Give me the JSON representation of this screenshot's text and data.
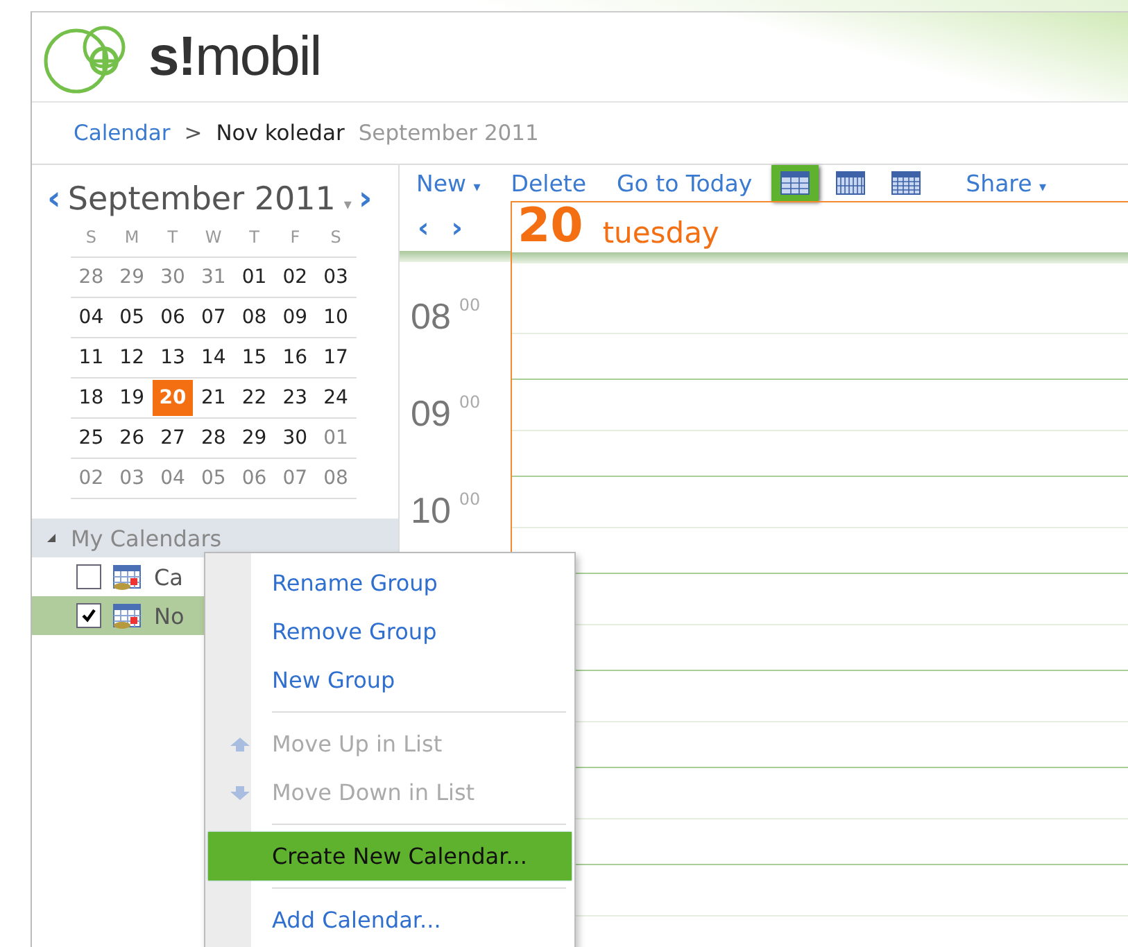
{
  "brand": {
    "name_left": "s!",
    "name_right": "mobil"
  },
  "breadcrumb": {
    "root": "Calendar",
    "separator": ">",
    "current": "Nov koledar",
    "date": "September 2011"
  },
  "mini_calendar": {
    "prev": "‹",
    "title": "September 2011",
    "dropdown": "▾",
    "next": "›",
    "weekdays": [
      "S",
      "M",
      "T",
      "W",
      "T",
      "F",
      "S"
    ],
    "weeks": [
      [
        {
          "day": "28",
          "muted": true,
          "selected": false
        },
        {
          "day": "29",
          "muted": true,
          "selected": false
        },
        {
          "day": "30",
          "muted": true,
          "selected": false
        },
        {
          "day": "31",
          "muted": true,
          "selected": false
        },
        {
          "day": "01",
          "muted": false,
          "selected": false
        },
        {
          "day": "02",
          "muted": false,
          "selected": false
        },
        {
          "day": "03",
          "muted": false,
          "selected": false
        }
      ],
      [
        {
          "day": "04",
          "muted": false,
          "selected": false
        },
        {
          "day": "05",
          "muted": false,
          "selected": false
        },
        {
          "day": "06",
          "muted": false,
          "selected": false
        },
        {
          "day": "07",
          "muted": false,
          "selected": false
        },
        {
          "day": "08",
          "muted": false,
          "selected": false
        },
        {
          "day": "09",
          "muted": false,
          "selected": false
        },
        {
          "day": "10",
          "muted": false,
          "selected": false
        }
      ],
      [
        {
          "day": "11",
          "muted": false,
          "selected": false
        },
        {
          "day": "12",
          "muted": false,
          "selected": false
        },
        {
          "day": "13",
          "muted": false,
          "selected": false
        },
        {
          "day": "14",
          "muted": false,
          "selected": false
        },
        {
          "day": "15",
          "muted": false,
          "selected": false
        },
        {
          "day": "16",
          "muted": false,
          "selected": false
        },
        {
          "day": "17",
          "muted": false,
          "selected": false
        }
      ],
      [
        {
          "day": "18",
          "muted": false,
          "selected": false
        },
        {
          "day": "19",
          "muted": false,
          "selected": false
        },
        {
          "day": "20",
          "muted": false,
          "selected": true
        },
        {
          "day": "21",
          "muted": false,
          "selected": false
        },
        {
          "day": "22",
          "muted": false,
          "selected": false
        },
        {
          "day": "23",
          "muted": false,
          "selected": false
        },
        {
          "day": "24",
          "muted": false,
          "selected": false
        }
      ],
      [
        {
          "day": "25",
          "muted": false,
          "selected": false
        },
        {
          "day": "26",
          "muted": false,
          "selected": false
        },
        {
          "day": "27",
          "muted": false,
          "selected": false
        },
        {
          "day": "28",
          "muted": false,
          "selected": false
        },
        {
          "day": "29",
          "muted": false,
          "selected": false
        },
        {
          "day": "30",
          "muted": false,
          "selected": false
        },
        {
          "day": "01",
          "muted": true,
          "selected": false
        }
      ],
      [
        {
          "day": "02",
          "muted": true,
          "selected": false
        },
        {
          "day": "03",
          "muted": true,
          "selected": false
        },
        {
          "day": "04",
          "muted": true,
          "selected": false
        },
        {
          "day": "05",
          "muted": true,
          "selected": false
        },
        {
          "day": "06",
          "muted": true,
          "selected": false
        },
        {
          "day": "07",
          "muted": true,
          "selected": false
        },
        {
          "day": "08",
          "muted": true,
          "selected": false
        }
      ]
    ]
  },
  "calendars": {
    "group": "My Calendars",
    "expanded": true,
    "items": [
      {
        "name": "Ca",
        "checked": false,
        "selected": false
      },
      {
        "name": "No",
        "checked": true,
        "selected": true
      }
    ]
  },
  "toolbar": {
    "new": "New",
    "new_caret": "▾",
    "delete": "Delete",
    "today": "Go to Today",
    "views": [
      {
        "selected": true
      },
      {
        "selected": false
      },
      {
        "selected": false
      }
    ],
    "share": "Share",
    "share_caret": "▾"
  },
  "day_view": {
    "prev": "‹",
    "next": "›",
    "day_number": "20",
    "day_name": "tuesday",
    "hours": [
      {
        "hour": "08",
        "minutes": "00"
      },
      {
        "hour": "09",
        "minutes": "00"
      },
      {
        "hour": "10",
        "minutes": "00"
      }
    ]
  },
  "context_menu": {
    "items": [
      {
        "kind": "plain",
        "label": "Rename Group",
        "disabled": false,
        "selected": false
      },
      {
        "kind": "plain",
        "label": "Remove Group",
        "disabled": false,
        "selected": false
      },
      {
        "kind": "plain",
        "label": "New Group",
        "disabled": false,
        "selected": false
      },
      {
        "kind": "separator"
      },
      {
        "kind": "move-up",
        "label": "Move Up in List",
        "disabled": true,
        "selected": false
      },
      {
        "kind": "move-down",
        "label": "Move Down in List",
        "disabled": true,
        "selected": false
      },
      {
        "kind": "separator"
      },
      {
        "kind": "plain",
        "label": "Create New Calendar...",
        "disabled": false,
        "selected": true
      },
      {
        "kind": "separator"
      },
      {
        "kind": "plain",
        "label": "Add Calendar...",
        "disabled": false,
        "selected": false
      }
    ]
  }
}
